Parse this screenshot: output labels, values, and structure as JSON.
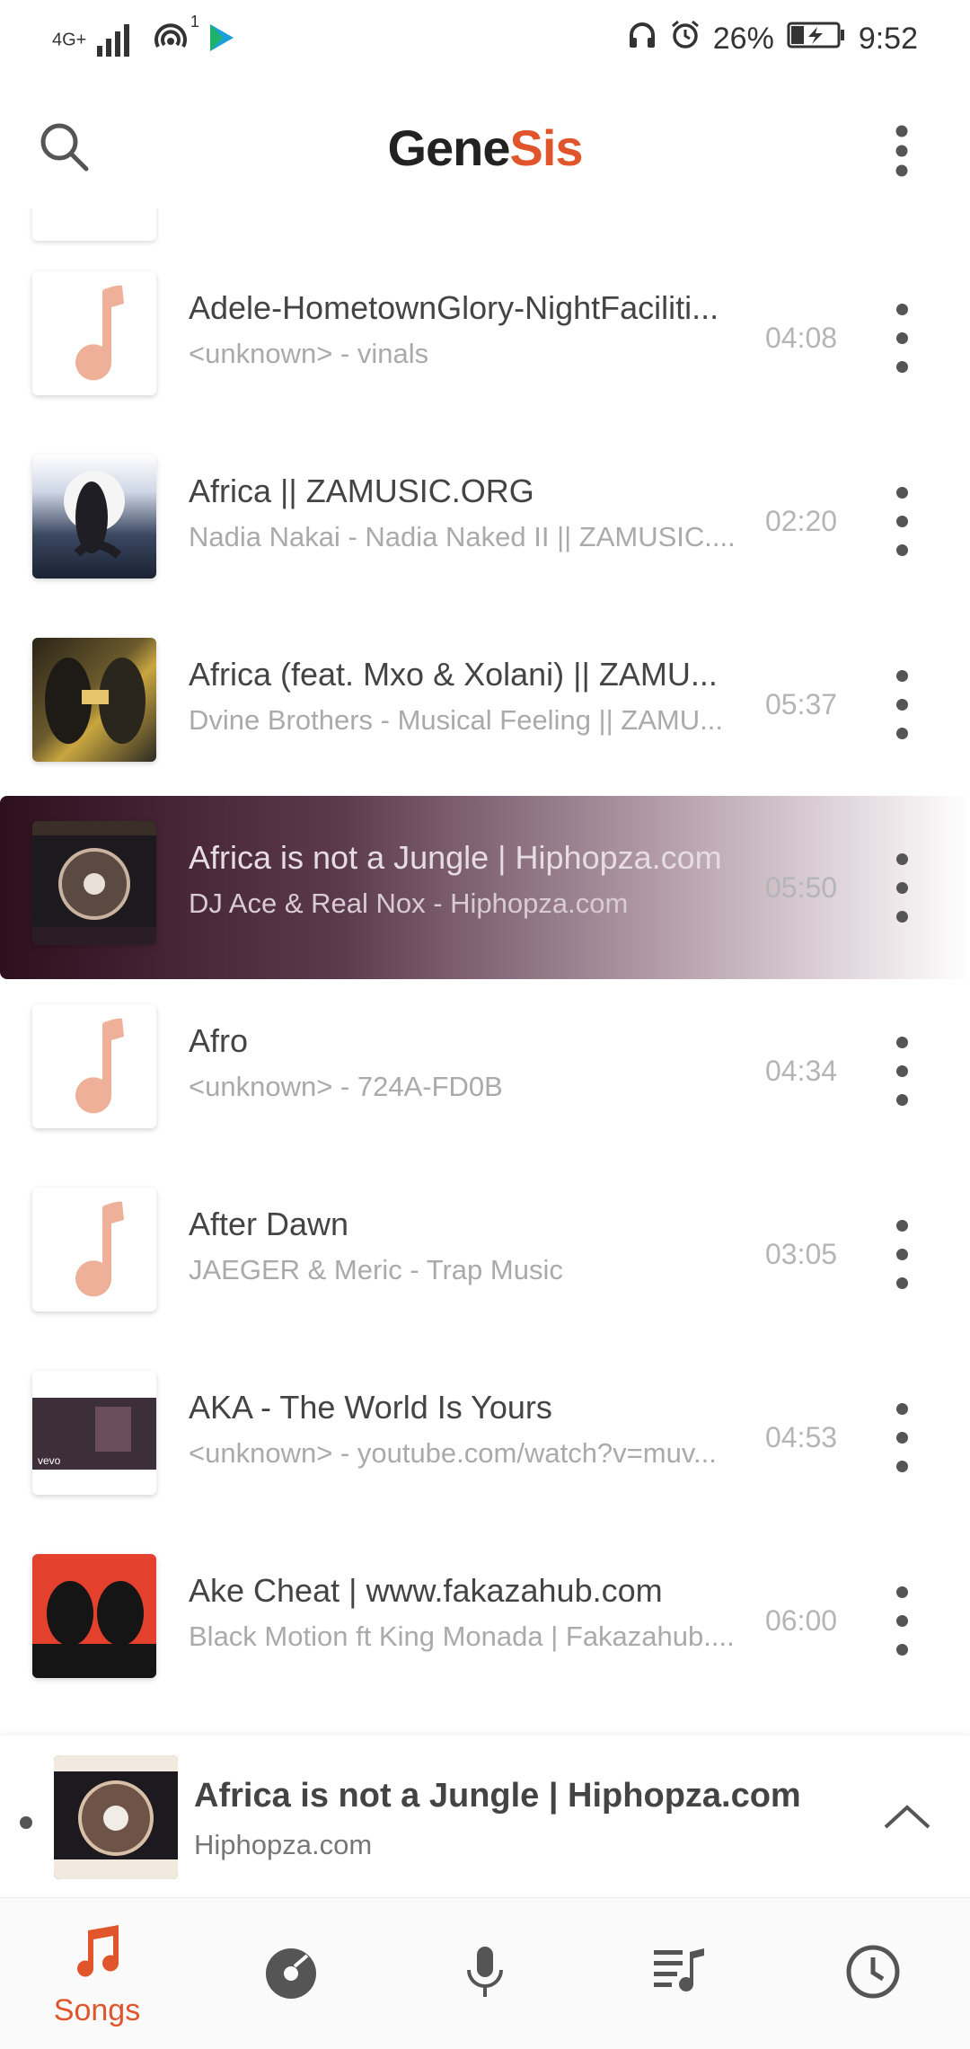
{
  "status_bar": {
    "network": "4G+",
    "hotspot_badge": "1",
    "battery": "26%",
    "time": "9:52"
  },
  "app": {
    "title_part1": "Gene",
    "title_part2": "Sis",
    "accent": "#e0552c"
  },
  "songs": [
    {
      "title": "Adele-HometownGlory-NightFaciliti...",
      "subtitle": "<unknown> - vinals",
      "duration": "04:08"
    },
    {
      "title": "Africa || ZAMUSIC.ORG",
      "subtitle": "Nadia Nakai - Nadia Naked II || ZAMUSIC....",
      "duration": "02:20"
    },
    {
      "title": "Africa (feat. Mxo & Xolani) || ZAMU...",
      "subtitle": "Dvine Brothers - Musical Feeling || ZAMU...",
      "duration": "05:37"
    },
    {
      "title": "Africa is not a Jungle | Hiphopza.com",
      "subtitle": "DJ Ace & Real Nox - Hiphopza.com",
      "duration": "05:50"
    },
    {
      "title": "Afro",
      "subtitle": "<unknown> - 724A-FD0B",
      "duration": "04:34"
    },
    {
      "title": "After Dawn",
      "subtitle": "JAEGER & Meric - Trap Music",
      "duration": "03:05"
    },
    {
      "title": "AKA - The World Is Yours",
      "subtitle": "<unknown> - youtube.com/watch?v=muv...",
      "duration": "04:53"
    },
    {
      "title": "Ake Cheat | www.fakazahub.com",
      "subtitle": "Black Motion ft King Monada | Fakazahub....",
      "duration": "06:00"
    }
  ],
  "now_playing": {
    "title": "Africa is not a Jungle | Hiphopza.com",
    "artist": "Hiphopza.com"
  },
  "bottom_nav": {
    "songs_label": "Songs"
  }
}
